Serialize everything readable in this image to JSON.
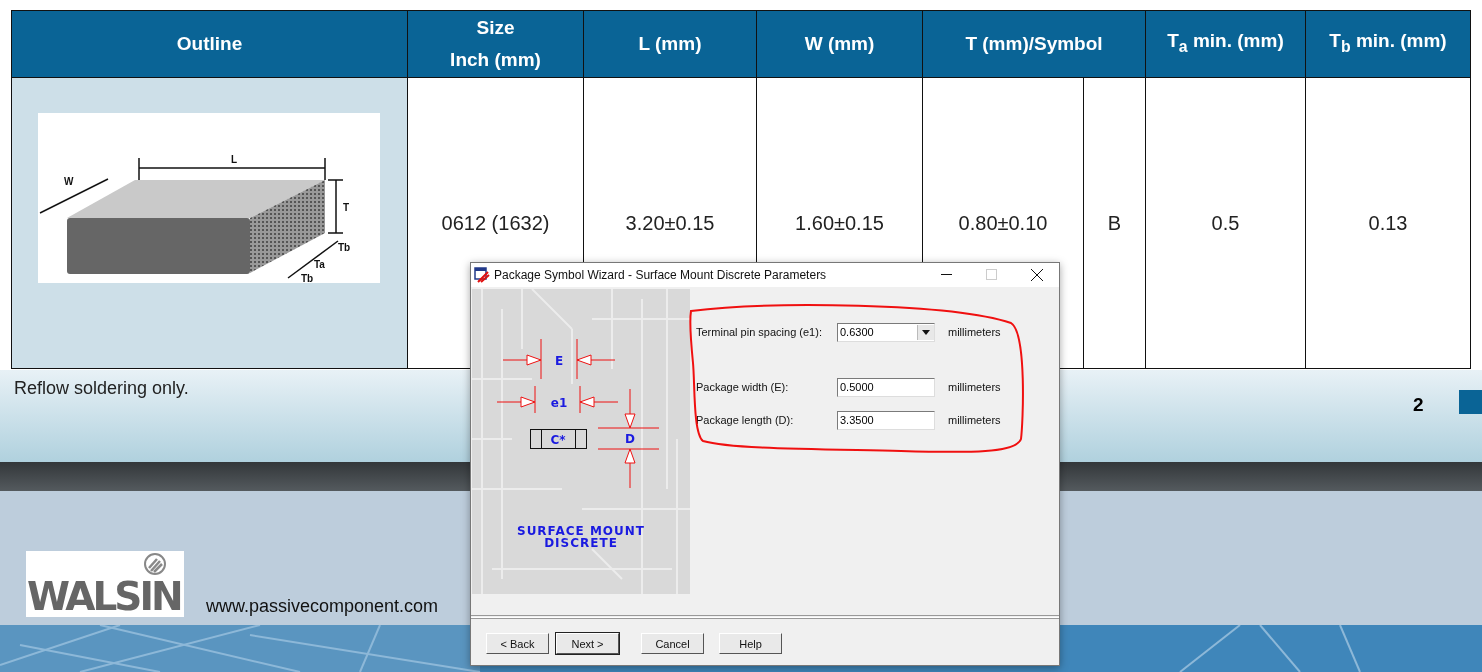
{
  "document": {
    "table": {
      "columns": [
        {
          "lines": [
            "Outline"
          ]
        },
        {
          "lines": [
            "Size",
            "Inch (mm)"
          ]
        },
        {
          "lines": [
            "L (mm)"
          ]
        },
        {
          "lines": [
            "W (mm)"
          ]
        },
        {
          "lines": [
            "T (mm)/Symbol"
          ]
        },
        {
          "lines": [
            "T$_{a}$ min. (mm)"
          ]
        },
        {
          "lines": [
            "T$_{b}$ min. (mm)"
          ]
        }
      ],
      "rows": [
        {
          "cells": [
            {
              "kind": "figure",
              "labels": [
                "L",
                "W",
                "T",
                "Tb",
                "Ta",
                "Tb"
              ]
            },
            {
              "kind": "text",
              "text": "0612 (1632)"
            },
            {
              "kind": "text",
              "text": "3.20±0.15"
            },
            {
              "kind": "text",
              "text": "1.60±0.15"
            },
            {
              "kind": "text",
              "text": "0.80±0.10",
              "symbol": "B"
            },
            {
              "kind": "text",
              "text": "0.5"
            },
            {
              "kind": "text",
              "text": "0.13"
            }
          ]
        }
      ]
    },
    "note": "Reflow soldering only.",
    "page_number": "2",
    "logo": "WALSIN",
    "website": "www.passivecomponent.com"
  },
  "dialog": {
    "title": "Package Symbol Wizard - Surface Mount Discrete Parameters",
    "diagram": {
      "labels": [
        "E",
        "e1",
        "C*",
        "D"
      ],
      "caption": [
        "SURFACE MOUNT",
        "DISCRETE"
      ]
    },
    "fields": [
      {
        "kind": "dropdown",
        "label": "Terminal pin spacing (e1):",
        "value": "0.6300",
        "unit": "millimeters"
      },
      {
        "kind": "text",
        "label": "Package width (E):",
        "value": "0.5000",
        "unit": "millimeters"
      },
      {
        "kind": "text",
        "label": "Package length (D):",
        "value": "3.3500",
        "unit": "millimeters"
      }
    ],
    "buttons": [
      {
        "label": "< Back",
        "default": false
      },
      {
        "label": "Next >",
        "default": true
      },
      {
        "label": "Cancel",
        "default": false
      },
      {
        "label": "Help",
        "default": false
      }
    ]
  }
}
